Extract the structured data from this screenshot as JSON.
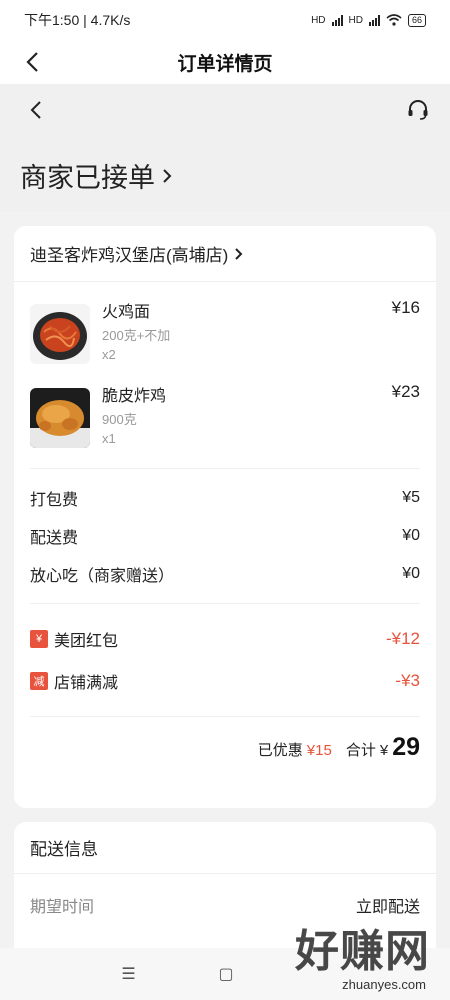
{
  "status_bar": {
    "time_speed": "下午1:50 | 4.7K/s",
    "network1": "HD",
    "network2": "HD",
    "battery": "66"
  },
  "header": {
    "title": "订单详情页"
  },
  "order": {
    "status": "商家已接单"
  },
  "shop": {
    "name": "迪圣客炸鸡汉堡店(高埔店)"
  },
  "items": [
    {
      "name": "火鸡面",
      "spec": "200克+不加",
      "qty": "x2",
      "price": "¥16"
    },
    {
      "name": "脆皮炸鸡",
      "spec": "900克",
      "qty": "x1",
      "price": "¥23"
    }
  ],
  "fees": [
    {
      "label": "打包费",
      "value": "¥5"
    },
    {
      "label": "配送费",
      "value": "¥0"
    },
    {
      "label": "放心吃（商家赠送）",
      "value": "¥0"
    }
  ],
  "discounts": [
    {
      "tag": "¥",
      "label": "美团红包",
      "value": "-¥12"
    },
    {
      "tag": "减",
      "label": "店铺满减",
      "value": "-¥3"
    }
  ],
  "totals": {
    "saved_label": "已优惠",
    "saved_value": "¥15",
    "total_label": "合计",
    "currency": "¥",
    "total_value": "29"
  },
  "delivery": {
    "title": "配送信息",
    "expected_label": "期望时间",
    "expected_value": "立即配送"
  },
  "watermark": {
    "main": "好赚网",
    "sub": "zhuanyes.com"
  },
  "colors": {
    "accent": "#e8533d"
  },
  "icons": [
    "back-icon",
    "headset-icon",
    "chevron-right-icon",
    "menu-icon",
    "home-square-icon"
  ]
}
